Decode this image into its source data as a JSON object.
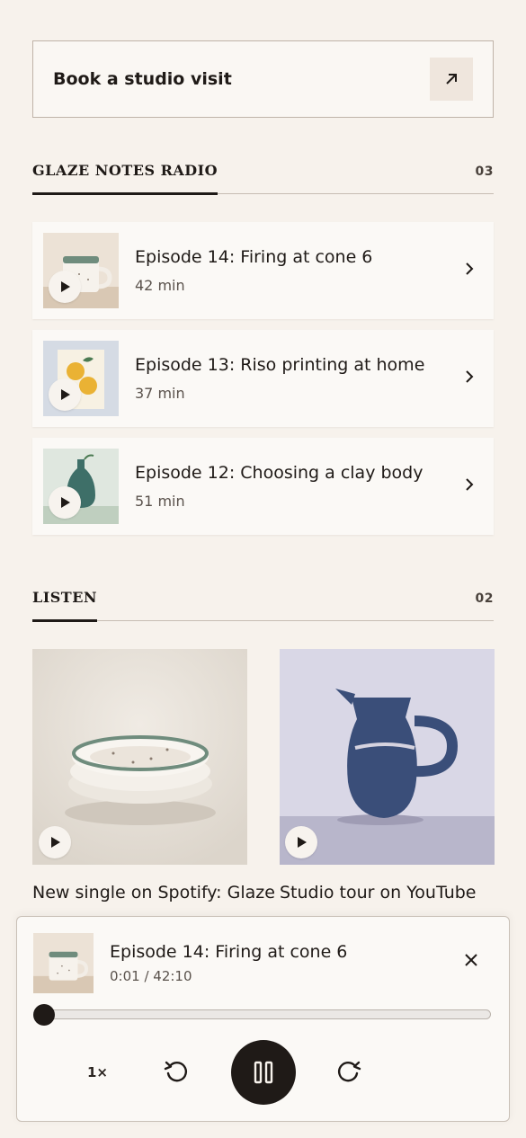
{
  "book": {
    "label": "Book a studio visit",
    "icon": "arrow-up-right-icon"
  },
  "radio": {
    "title": "GLAZE NOTES RADIO",
    "count": "03",
    "episodes": [
      {
        "title": "Episode 14: Firing at cone 6",
        "duration": "42 min",
        "thumb": "mug"
      },
      {
        "title": "Episode 13: Riso printing at home",
        "duration": "37 min",
        "thumb": "lemons-print"
      },
      {
        "title": "Episode 12: Choosing a clay body",
        "duration": "51 min",
        "thumb": "green-vase"
      }
    ]
  },
  "listen": {
    "title": "LISTEN",
    "count": "02",
    "items": [
      {
        "caption": "New single on Spotify: Glaze",
        "thumb": "stacked-bowls"
      },
      {
        "caption": "Studio tour on YouTube",
        "thumb": "blue-pitcher"
      }
    ]
  },
  "player": {
    "title": "Episode 14: Firing at cone 6",
    "time": "0:01 / 42:10",
    "progress": 0.0004,
    "speed": "1×",
    "state": "playing"
  },
  "colors": {
    "background": "#f7f2ec",
    "ink": "#1f1a17",
    "card": "#fbf9f6"
  }
}
